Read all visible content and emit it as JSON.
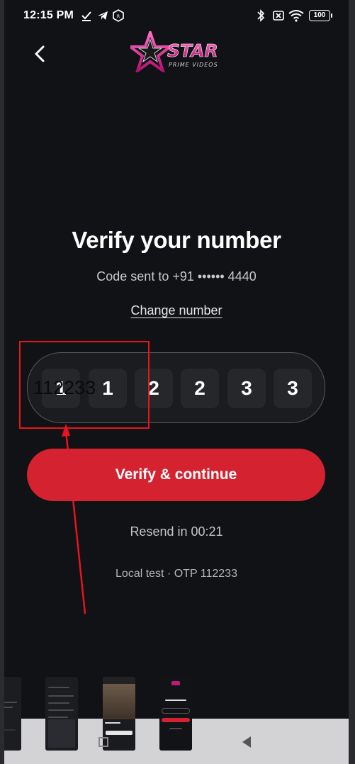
{
  "status_bar": {
    "time": "12:15 PM",
    "battery": "100",
    "icons": [
      "check-download-icon",
      "telegram-icon",
      "rcs-icon",
      "bluetooth-icon",
      "sim-off-icon",
      "wifi-icon",
      "battery-icon"
    ]
  },
  "header": {
    "back_icon": "chevron-left-icon",
    "logo_text": "STAR",
    "logo_subtext": "PRIME VIDEOS"
  },
  "verify": {
    "title": "Verify your number",
    "code_sent": "Code sent to +91 •••••• 4440",
    "change_number": "Change number",
    "otp_raw_value": "112233",
    "otp_digits": [
      "1",
      "1",
      "2",
      "2",
      "3",
      "3"
    ],
    "button_label": "Verify & continue",
    "resend_text": "Resend in 00:21",
    "local_test": "Local test · OTP 112233"
  },
  "colors": {
    "background": "#111215",
    "accent": "#d52230",
    "otp_box": "#26272b",
    "annotation": "#e8131f"
  }
}
